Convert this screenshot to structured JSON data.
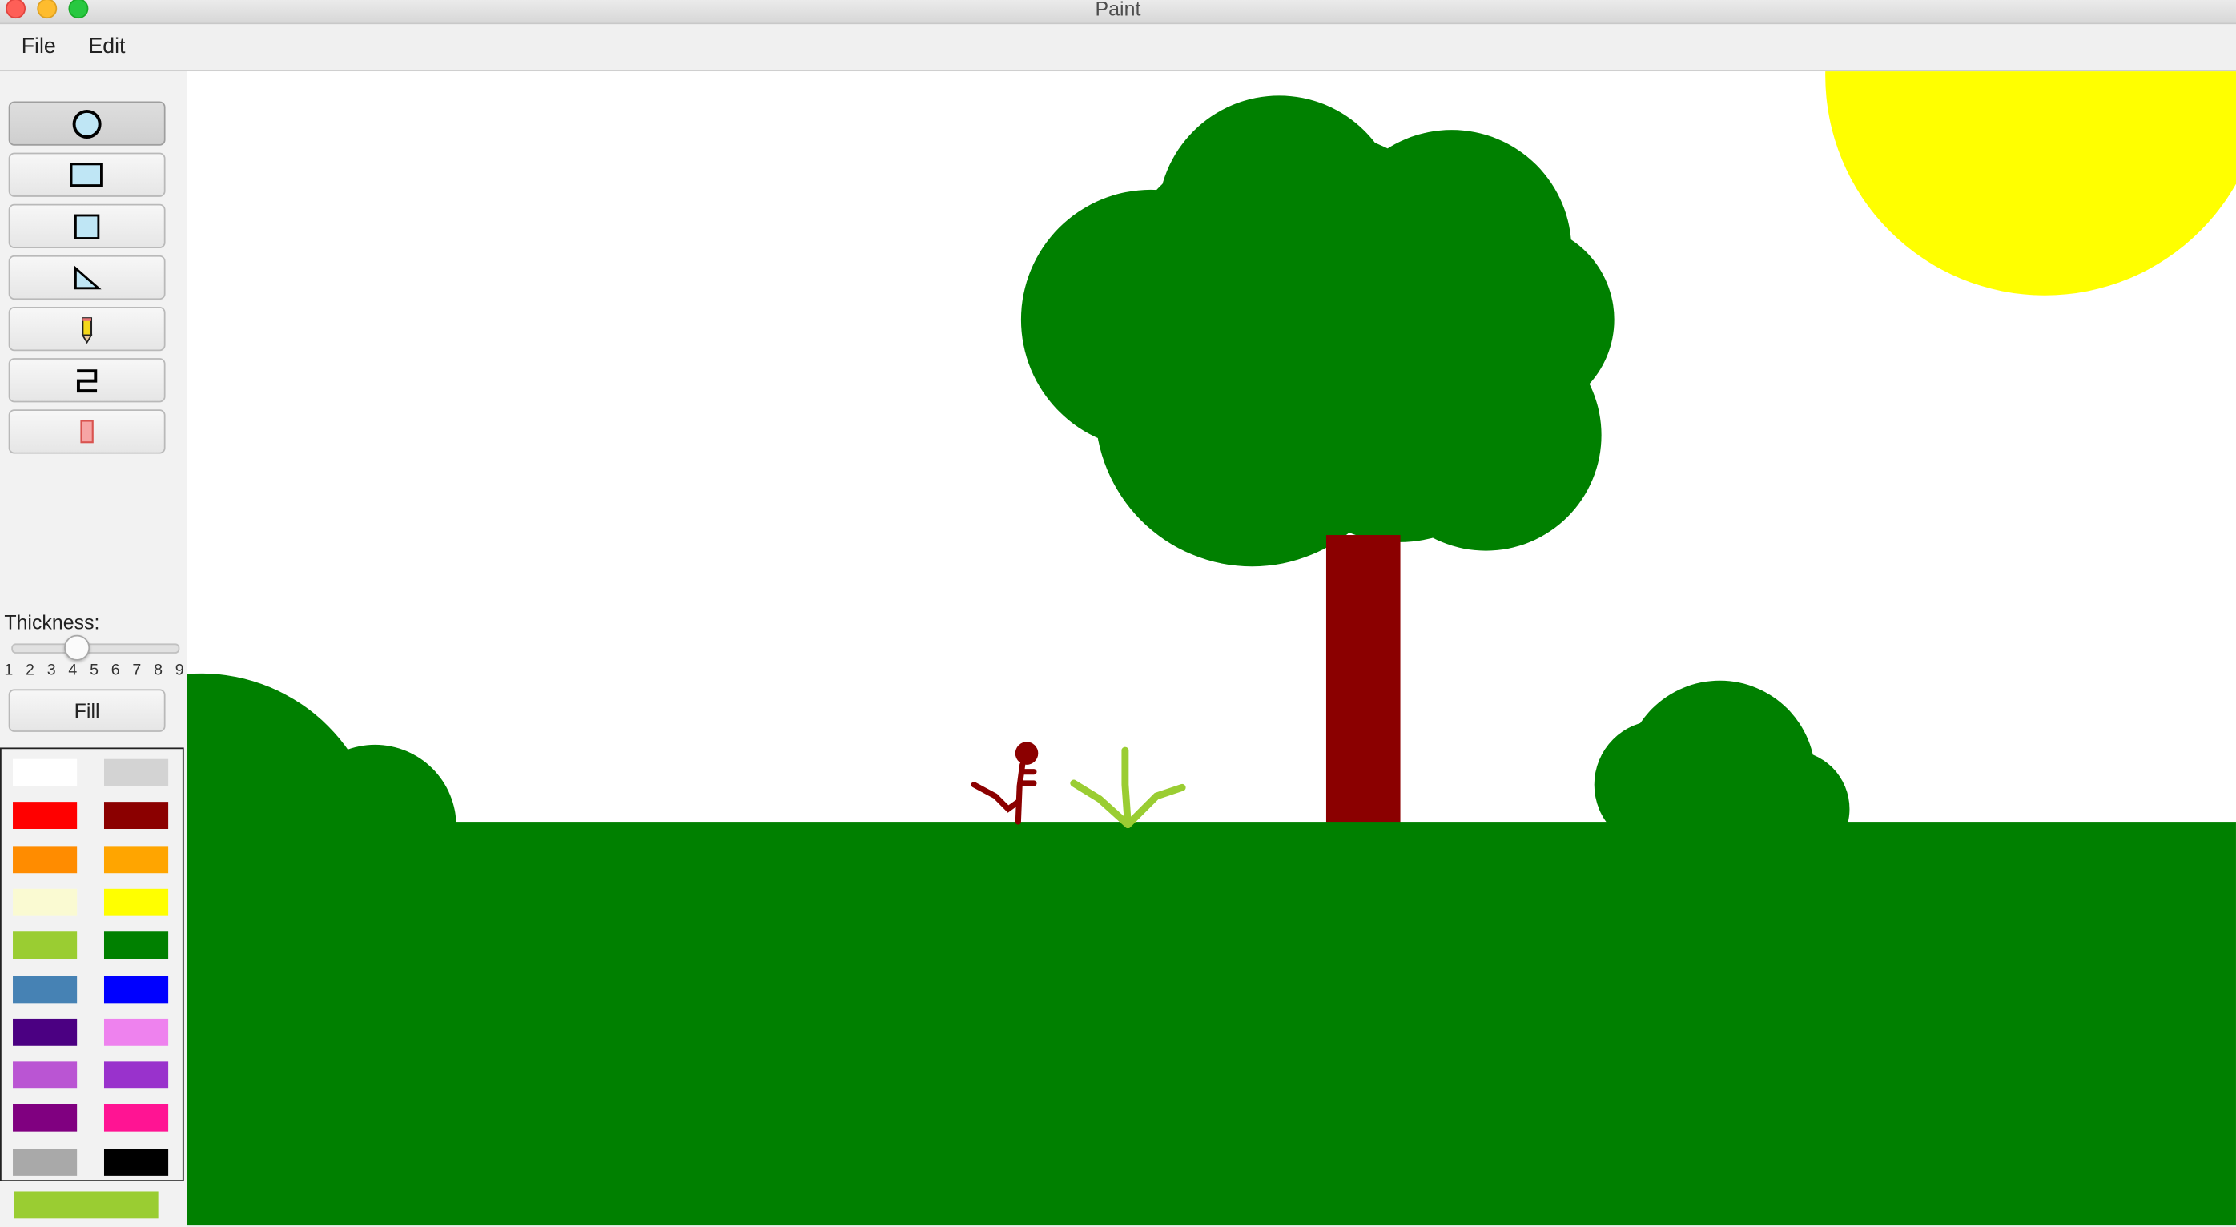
{
  "window": {
    "title": "Paint"
  },
  "menu": {
    "items": [
      "File",
      "Edit"
    ]
  },
  "tools": [
    {
      "name": "ellipse",
      "icon": "circle-icon",
      "selected": true
    },
    {
      "name": "rectangle",
      "icon": "rectangle-icon",
      "selected": false
    },
    {
      "name": "square",
      "icon": "square-icon",
      "selected": false
    },
    {
      "name": "triangle",
      "icon": "triangle-icon",
      "selected": false
    },
    {
      "name": "pencil",
      "icon": "pencil-icon",
      "selected": false
    },
    {
      "name": "line",
      "icon": "polyline-icon",
      "selected": false
    },
    {
      "name": "eraser",
      "icon": "eraser-icon",
      "selected": false
    }
  ],
  "thickness": {
    "label": "Thickness:",
    "ticks": [
      "1",
      "2",
      "3",
      "4",
      "5",
      "6",
      "7",
      "8",
      "9"
    ],
    "value": 4
  },
  "fill_label": "Fill",
  "palette": [
    "#ffffff",
    "#d3d3d3",
    "#ff0000",
    "#8b0000",
    "#ff8c00",
    "#ffa500",
    "#fafad2",
    "#ffff00",
    "#9acd32",
    "#008000",
    "#4682b4",
    "#0000ff",
    "#4b0082",
    "#ee82ee",
    "#ba55d3",
    "#9932cc",
    "#800080",
    "#ff1493",
    "#a9a9a9",
    "#000000"
  ],
  "current_color": "#9acd32",
  "scene_colors": {
    "grass": "#008000",
    "tree_trunk": "#8b0000",
    "sun": "#ffff00",
    "plant": "#9acd32",
    "figure": "#8b0000"
  }
}
